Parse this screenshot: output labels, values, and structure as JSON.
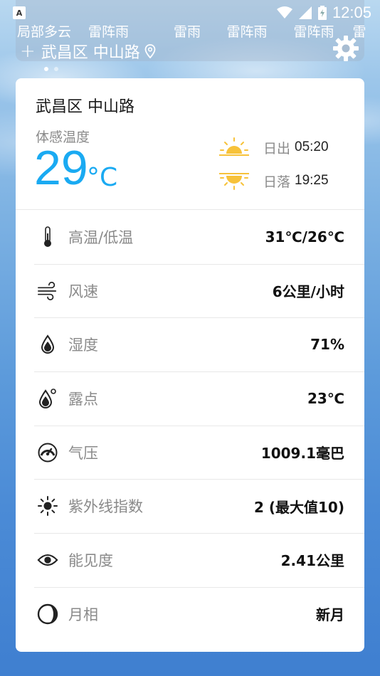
{
  "status_bar": {
    "notif_letter": "A",
    "time": "12:05"
  },
  "forecast": {
    "items": [
      "局部多云",
      "雷阵雨",
      "雷雨",
      "雷阵雨",
      "雷阵雨",
      "雷"
    ]
  },
  "location_bar": {
    "location": "武昌区 中山路"
  },
  "pager": {
    "pages": 2,
    "active": 1
  },
  "card": {
    "title": "武昌区 中山路",
    "feels_label": "体感温度",
    "feels_value": "29",
    "feels_unit": "°C",
    "sunrise_label": "日出",
    "sunrise_time": "05:20",
    "sunset_label": "日落",
    "sunset_time": "19:25",
    "details": [
      {
        "icon": "thermometer-icon",
        "label": "高温/低温",
        "value": "31℃/26℃"
      },
      {
        "icon": "wind-icon",
        "label": "风速",
        "value": "6公里/小时"
      },
      {
        "icon": "humidity-drop-icon",
        "label": "湿度",
        "value": "71%"
      },
      {
        "icon": "dew-point-icon",
        "label": "露点",
        "value": "23℃"
      },
      {
        "icon": "pressure-gauge-icon",
        "label": "气压",
        "value": "1009.1毫巴"
      },
      {
        "icon": "uv-sun-icon",
        "label": "紫外线指数",
        "value": "2 (最大值10)"
      },
      {
        "icon": "eye-icon",
        "label": "能见度",
        "value": "2.41公里"
      },
      {
        "icon": "moon-phase-icon",
        "label": "月相",
        "value": "新月"
      }
    ]
  },
  "colors": {
    "accent": "#1aaaf2",
    "sun": "#f7c23a"
  }
}
